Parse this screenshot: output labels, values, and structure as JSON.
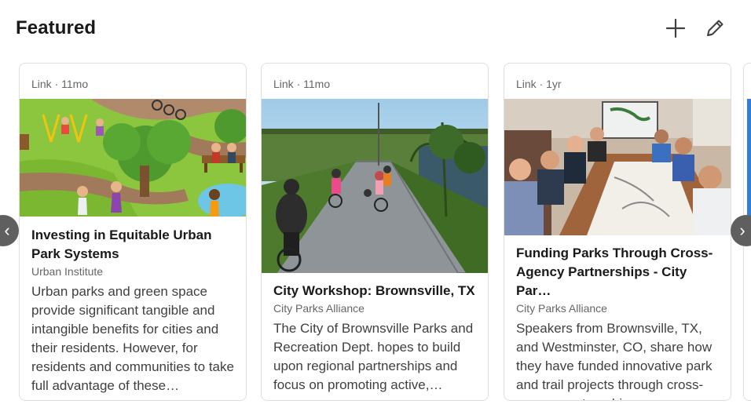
{
  "section": {
    "title": "Featured",
    "add_icon": "plus-icon",
    "edit_icon": "pencil-icon"
  },
  "cards": [
    {
      "meta": "Link · 11mo",
      "title": "Investing in Equitable Urban Park Systems",
      "source": "Urban Institute",
      "description": "Urban parks and green space provide significant tangible and intangible benefits for cities and their residents. However, for residents and communities to take full advantage of these…",
      "image": "illustration-park-people"
    },
    {
      "meta": "Link · 11mo",
      "title": "City Workshop: Brownsville, TX",
      "source": "City Parks Alliance",
      "description": "The City of Brownsville Parks and Recreation Dept. hopes to build upon regional partnerships and focus on promoting active,…",
      "image": "photo-cyclists-trail"
    },
    {
      "meta": "Link · 1yr",
      "title": "Funding Parks Through Cross-Agency Partnerships - City Par…",
      "source": "City Parks Alliance",
      "description": "Speakers from Brownsville, TX, and Westminster, CO, share how they have funded innovative park and trail projects through cross-agency partnerships.",
      "image": "photo-conference-room"
    }
  ],
  "nav": {
    "prev_glyph": "‹",
    "next_glyph": "›"
  },
  "colors": {
    "border": "#e0dfdc",
    "meta_text": "#666666",
    "arrow_bg": "#5f5f5f"
  }
}
